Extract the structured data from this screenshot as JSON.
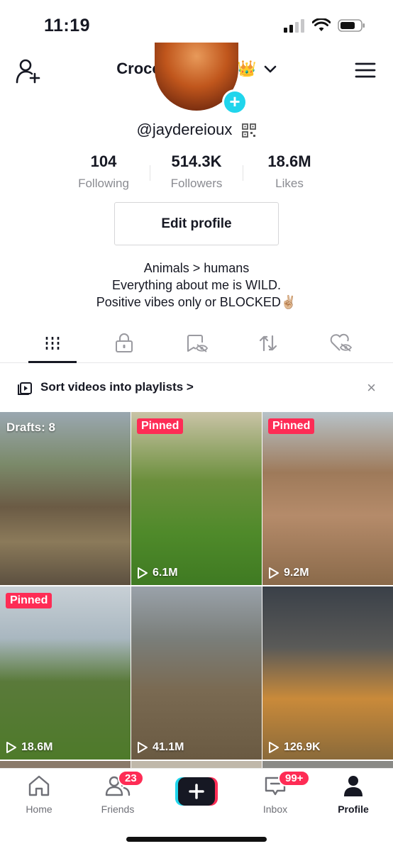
{
  "status_bar": {
    "time": "11:19"
  },
  "header": {
    "title": "CrocodileQueen",
    "title_emoji": "👑"
  },
  "profile": {
    "handle": "@jaydereioux",
    "avatar_plus": "+",
    "stats": [
      {
        "value": "104",
        "label": "Following"
      },
      {
        "value": "514.3K",
        "label": "Followers"
      },
      {
        "value": "18.6M",
        "label": "Likes"
      }
    ],
    "edit_button": "Edit profile",
    "bio": [
      "Animals > humans",
      "Everything about me is WILD.",
      "Positive vibes only or BLOCKED✌🏼"
    ]
  },
  "tabs": [
    {
      "icon": "grid-icon",
      "active": true
    },
    {
      "icon": "lock-icon",
      "active": false
    },
    {
      "icon": "saved-hidden-icon",
      "active": false
    },
    {
      "icon": "repost-icon",
      "active": false
    },
    {
      "icon": "liked-hidden-icon",
      "active": false
    }
  ],
  "playlist_banner": {
    "text": "Sort videos into playlists >",
    "close": "×"
  },
  "videos": [
    {
      "overlay": "Drafts: 8",
      "type": "drafts",
      "views": ""
    },
    {
      "overlay": "Pinned",
      "type": "pinned",
      "views": "6.1M"
    },
    {
      "overlay": "Pinned",
      "type": "pinned",
      "views": "9.2M"
    },
    {
      "overlay": "Pinned",
      "type": "pinned",
      "views": "18.6M"
    },
    {
      "overlay": "",
      "type": "normal",
      "views": "41.1M"
    },
    {
      "overlay": "",
      "type": "normal",
      "views": "126.9K"
    }
  ],
  "bottom_nav": [
    {
      "label": "Home",
      "badge": ""
    },
    {
      "label": "Friends",
      "badge": "23"
    },
    {
      "label": "",
      "badge": ""
    },
    {
      "label": "Inbox",
      "badge": "99+"
    },
    {
      "label": "Profile",
      "badge": ""
    }
  ],
  "colors": {
    "accent": "#fe2c55",
    "cyan": "#20d5ec",
    "text": "#161823",
    "muted": "#8a8b91"
  }
}
